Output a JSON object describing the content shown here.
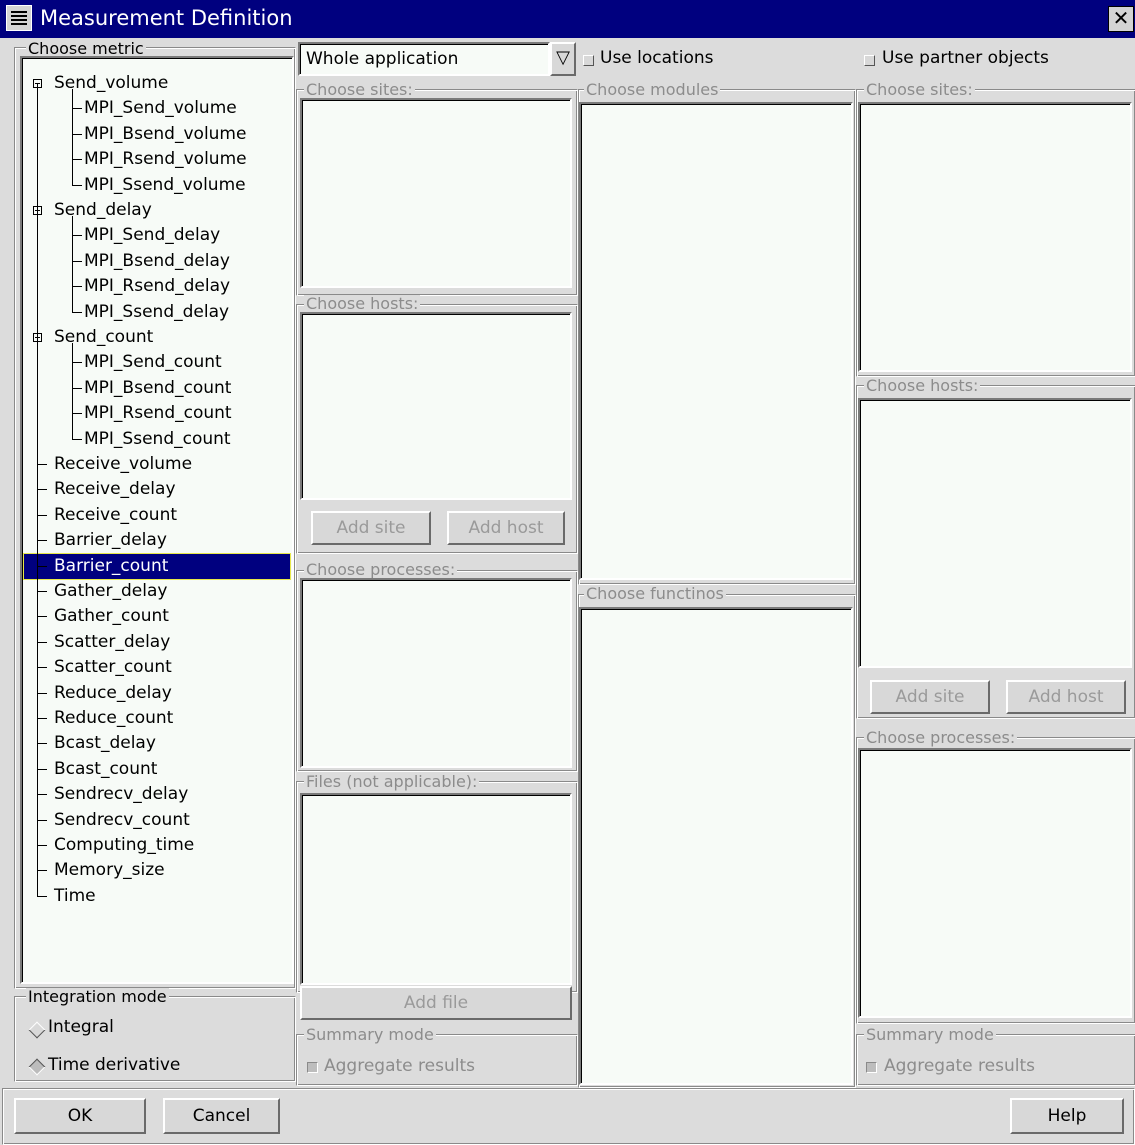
{
  "window": {
    "title": "Measurement Definition",
    "close_glyph": "✕"
  },
  "metric_group": {
    "label": "Choose metric",
    "tree": [
      {
        "label": "Send_volume",
        "expandable": true,
        "children": [
          "MPI_Send_volume",
          "MPI_Bsend_volume",
          "MPI_Rsend_volume",
          "MPI_Ssend_volume"
        ]
      },
      {
        "label": "Send_delay",
        "expandable": true,
        "children": [
          "MPI_Send_delay",
          "MPI_Bsend_delay",
          "MPI_Rsend_delay",
          "MPI_Ssend_delay"
        ]
      },
      {
        "label": "Send_count",
        "expandable": true,
        "children": [
          "MPI_Send_count",
          "MPI_Bsend_count",
          "MPI_Rsend_count",
          "MPI_Ssend_count"
        ]
      },
      {
        "label": "Receive_volume"
      },
      {
        "label": "Receive_delay"
      },
      {
        "label": "Receive_count"
      },
      {
        "label": "Barrier_delay"
      },
      {
        "label": "Barrier_count",
        "selected": true
      },
      {
        "label": "Gather_delay"
      },
      {
        "label": "Gather_count"
      },
      {
        "label": "Scatter_delay"
      },
      {
        "label": "Scatter_count"
      },
      {
        "label": "Reduce_delay"
      },
      {
        "label": "Reduce_count"
      },
      {
        "label": "Bcast_delay"
      },
      {
        "label": "Bcast_count"
      },
      {
        "label": "Sendrecv_delay"
      },
      {
        "label": "Sendrecv_count"
      },
      {
        "label": "Computing_time"
      },
      {
        "label": "Memory_size"
      },
      {
        "label": "Time"
      }
    ]
  },
  "integration": {
    "label": "Integration mode",
    "options": [
      "Integral",
      "Time derivative"
    ],
    "selected": "Time derivative"
  },
  "scope": {
    "selected": "Whole application",
    "dropdown_glyph": "▽"
  },
  "left": {
    "sites_label": "Choose sites:",
    "hosts_label": "Choose hosts:",
    "add_site": "Add site",
    "add_host": "Add host",
    "processes_label": "Choose processes:",
    "files_label": "Files (not applicable):",
    "add_file": "Add file",
    "summary_label": "Summary mode",
    "aggregate": "Aggregate results"
  },
  "middle": {
    "use_locations": "Use locations",
    "modules_label": "Choose modules",
    "functions_label": "Choose functinos"
  },
  "right": {
    "use_partner": "Use partner objects",
    "sites_label": "Choose sites:",
    "hosts_label": "Choose hosts:",
    "add_site": "Add site",
    "add_host": "Add host",
    "processes_label": "Choose processes:",
    "summary_label": "Summary mode",
    "aggregate": "Aggregate results"
  },
  "footer": {
    "ok": "OK",
    "cancel": "Cancel",
    "help": "Help"
  },
  "colors": {
    "title_bar": "#00007f",
    "selection": "#00007f",
    "face": "#dcdcdc",
    "list_bg": "#f7fbf7",
    "disabled_text": "#8c8c8c"
  }
}
